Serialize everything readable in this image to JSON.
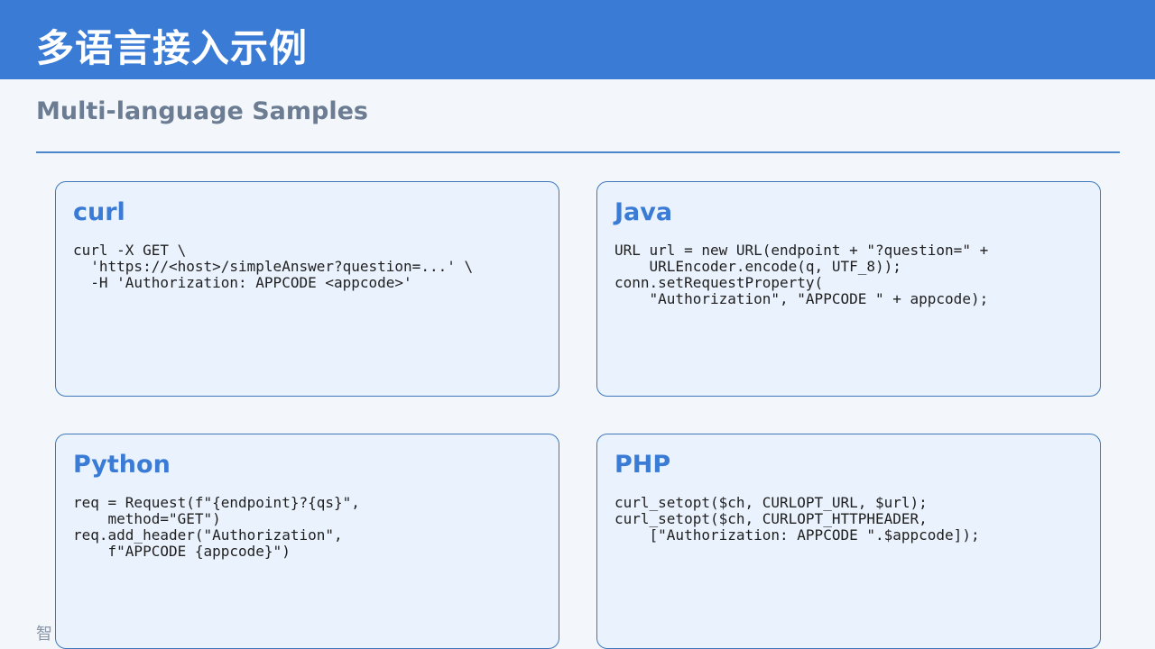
{
  "header": {
    "title": "多语言接入示例"
  },
  "subtitle": "Multi-language Samples",
  "footer": {
    "text": "智"
  },
  "colors": {
    "header_bg": "#3a7bd5",
    "page_bg": "#f3f7fc",
    "card_bg": "#eaf2fd",
    "card_border": "#3f78b8",
    "accent_text": "#3a7bd5",
    "subtitle_text": "#6b7c93"
  },
  "cards": [
    {
      "title": "curl",
      "code": "curl -X GET \\\n  'https://<host>/simpleAnswer?question=...' \\\n  -H 'Authorization: APPCODE <appcode>'"
    },
    {
      "title": "Java",
      "code": "URL url = new URL(endpoint + \"?question=\" +\n    URLEncoder.encode(q, UTF_8));\nconn.setRequestProperty(\n    \"Authorization\", \"APPCODE \" + appcode);"
    },
    {
      "title": "Python",
      "code": "req = Request(f\"{endpoint}?{qs}\",\n    method=\"GET\")\nreq.add_header(\"Authorization\",\n    f\"APPCODE {appcode}\")"
    },
    {
      "title": "PHP",
      "code": "curl_setopt($ch, CURLOPT_URL, $url);\ncurl_setopt($ch, CURLOPT_HTTPHEADER,\n    [\"Authorization: APPCODE \".$appcode]);"
    }
  ]
}
